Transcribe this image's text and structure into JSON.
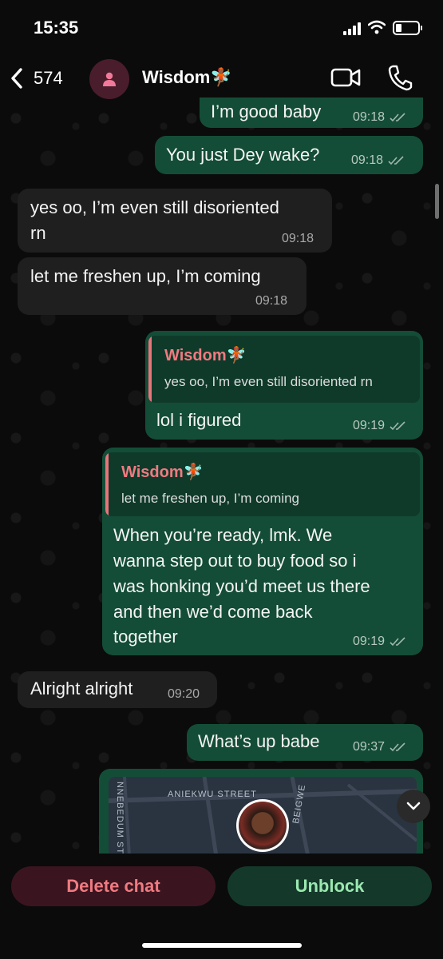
{
  "status": {
    "time": "15:35"
  },
  "header": {
    "back_count": "574",
    "contact_name": "Wisdom🧚🏾"
  },
  "messages": {
    "m1": {
      "text": "I’m good baby",
      "time": "09:18"
    },
    "m2": {
      "text": "You just Dey wake?",
      "time": "09:18"
    },
    "m3": {
      "line1": "yes oo, I’m even still disoriented",
      "line2": "rn",
      "time": "09:18"
    },
    "m4": {
      "text": "let me freshen up, I’m coming",
      "time": "09:18"
    },
    "m5": {
      "quote_name": "Wisdom🧚🏾",
      "quote_text": "yes oo, I’m even still disoriented rn",
      "text": "lol i figured",
      "time": "09:19"
    },
    "m6": {
      "quote_name": "Wisdom🧚🏾",
      "quote_text": "let me freshen up, I’m coming",
      "line1": "When you’re ready, lmk. We",
      "line2": "wanna step out to buy food so i",
      "line3": "was honking you’d meet us there",
      "line4": "and then we’d come back",
      "line5": "together",
      "time": "09:19"
    },
    "m7": {
      "text": "Alright alright",
      "time": "09:20"
    },
    "m8": {
      "text": "What’s up babe",
      "time": "09:37"
    },
    "map": {
      "street1": "ANIEKWU STREET",
      "street2": "NNEBEDUM STR",
      "street3": "BEIGWE"
    }
  },
  "actions": {
    "delete_label": "Delete chat",
    "unblock_label": "Unblock"
  },
  "colors": {
    "outgoing": "#144d37",
    "incoming": "#1f1f1f",
    "accent_name": "#f07a80",
    "unblock_text": "#9be8b0"
  }
}
